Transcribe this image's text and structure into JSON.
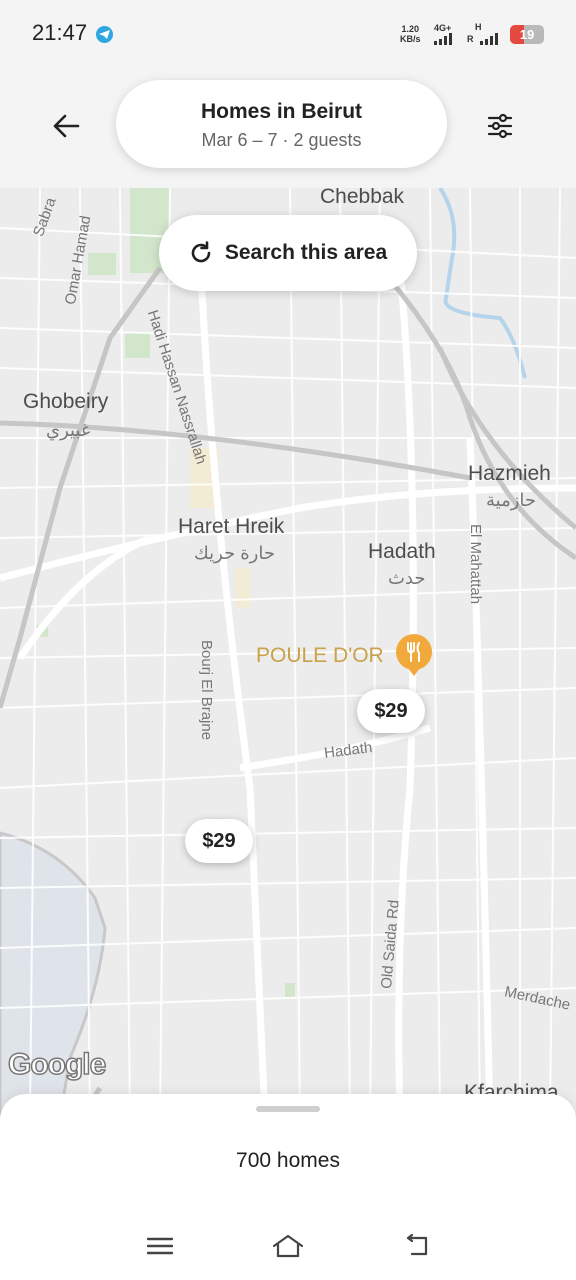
{
  "status_bar": {
    "time": "21:47",
    "net_speed_value": "1.20",
    "net_speed_unit": "KB/s",
    "network_type_1": "4G+",
    "network_type_2": "H",
    "roaming": "R",
    "battery": "19",
    "battery_level": 0.19,
    "battery_color": "#e5483f"
  },
  "header": {
    "title": "Homes in Beirut",
    "subtitle": "Mar 6 – 7 · 2 guests",
    "back_icon": "arrow-left-icon",
    "filter_icon": "sliders-icon"
  },
  "map": {
    "search_area_label": "Search this area",
    "refresh_icon": "refresh-icon",
    "labels": {
      "chebbak": "Chebbak",
      "sabra": "Sabra",
      "omar_hamad": "Omar Hamad",
      "hadi_hassan": "Hadi Hassan Nassrallah",
      "ghobeiry": "Ghobeiry",
      "ghobeiry_ar": "غبيري",
      "hazmieh": "Hazmieh",
      "hazmieh_ar": "حازمية",
      "haret_hreik": "Haret Hreik",
      "haret_hreik_ar": "حارة حريك",
      "hadath": "Hadath",
      "hadath_ar": "حدث",
      "el_mahattah": "El Mahattah",
      "bourj_el_brajne": "Bourj El Brajne",
      "hadath_road": "Hadath",
      "old_saida_rd": "Old Saida Rd",
      "merdache": "Merdache",
      "kfarchima": "Kfarchima",
      "poule_dor": "POULE D'OR"
    },
    "poi_icon": "restaurant-icon",
    "price_pins": [
      "$29",
      "$29"
    ],
    "attribution": "Google"
  },
  "bottom_sheet": {
    "homes_count": "700 homes"
  },
  "nav": {
    "menu_icon": "menu-icon",
    "home_icon": "home-icon",
    "back_icon": "back-icon"
  }
}
